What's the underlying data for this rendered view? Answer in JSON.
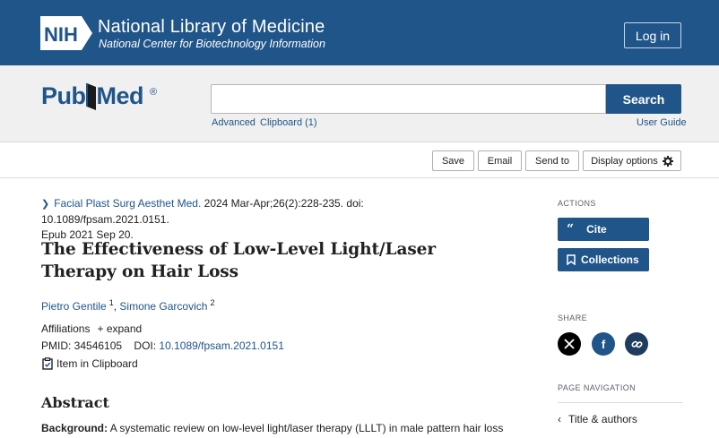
{
  "header": {
    "nih_badge": "NIH",
    "org_title": "National Library of Medicine",
    "org_subtitle": "National Center for Biotechnology Information",
    "login_label": "Log in",
    "brand_color": "#20558a"
  },
  "search": {
    "logo_pub": "Pub",
    "logo_med": "Med",
    "logo_reg": "®",
    "value": "",
    "placeholder": "",
    "button_label": "Search",
    "links": {
      "advanced": "Advanced",
      "clipboard": "Clipboard (1)",
      "user_guide": "User Guide"
    }
  },
  "toolbar": {
    "save": "Save",
    "email": "Email",
    "send_to": "Send to",
    "display_options": "Display options"
  },
  "article": {
    "journal": "Facial Plast Surg Aesthet Med.",
    "citation": " 2024 Mar-Apr;26(2):228-235. doi: 10.1089/fpsam.2021.0151.",
    "epub": "Epub 2021 Sep 20.",
    "title": "The Effectiveness of Low-Level Light/Laser Therapy on Hair Loss",
    "authors": [
      {
        "name": "Pietro Gentile",
        "aff": "1"
      },
      {
        "name": "Simone Garcovich",
        "aff": "2"
      }
    ],
    "author_sep": ",",
    "affiliations_label": "Affiliations",
    "expand_label": "+ expand",
    "pmid_label": "PMID: 34546105",
    "doi_label": "DOI:",
    "doi_value": "10.1089/fpsam.2021.0151",
    "clipboard_label": "Item in Clipboard",
    "abstract_heading": "Abstract",
    "background_label": "Background:",
    "background_text": " A systematic review on low-level light/laser therapy (LLLT) in male pattern hair loss"
  },
  "sidebar": {
    "actions_heading": "ACTIONS",
    "cite_label": "Cite",
    "collections_label": "Collections",
    "share_heading": "SHARE",
    "page_nav_heading": "PAGE NAVIGATION",
    "nav_title_authors": "Title & authors",
    "share_colors": {
      "x": "#000000",
      "facebook": "#20558a",
      "link": "#1f3c5e"
    }
  }
}
